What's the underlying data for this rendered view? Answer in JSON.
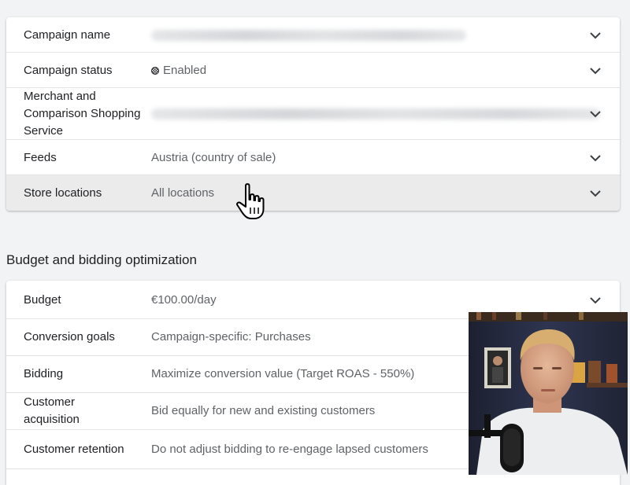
{
  "campaign_settings": {
    "rows": [
      {
        "label": "Campaign name",
        "value": ""
      },
      {
        "label": "Campaign status",
        "value": "Enabled"
      },
      {
        "label": "Merchant and Comparison Shopping Service",
        "value": ""
      },
      {
        "label": "Feeds",
        "value": "Austria (country of sale)"
      },
      {
        "label": "Store locations",
        "value": "All locations"
      }
    ]
  },
  "budget_section": {
    "title": "Budget and bidding optimization",
    "rows": [
      {
        "label": "Budget",
        "value": "€100.00/day"
      },
      {
        "label": "Conversion goals",
        "value": "Campaign-specific: Purchases"
      },
      {
        "label": "Bidding",
        "value": "Maximize conversion value (Target ROAS - 550%)"
      },
      {
        "label": "Customer acquisition",
        "value": "Bid equally for new and existing customers"
      },
      {
        "label": "Customer retention",
        "value": "Do not adjust bidding to re-engage lapsed customers"
      }
    ]
  },
  "icons": {
    "expand": "chevron-down-icon",
    "status": "status-enabled-icon",
    "pointer": "hand-pointer-icon"
  },
  "colors": {
    "background": "#f1f3f4",
    "card": "#ffffff",
    "hover_row": "#ebebeb",
    "label_text": "#202124",
    "value_text": "#5f6368"
  }
}
